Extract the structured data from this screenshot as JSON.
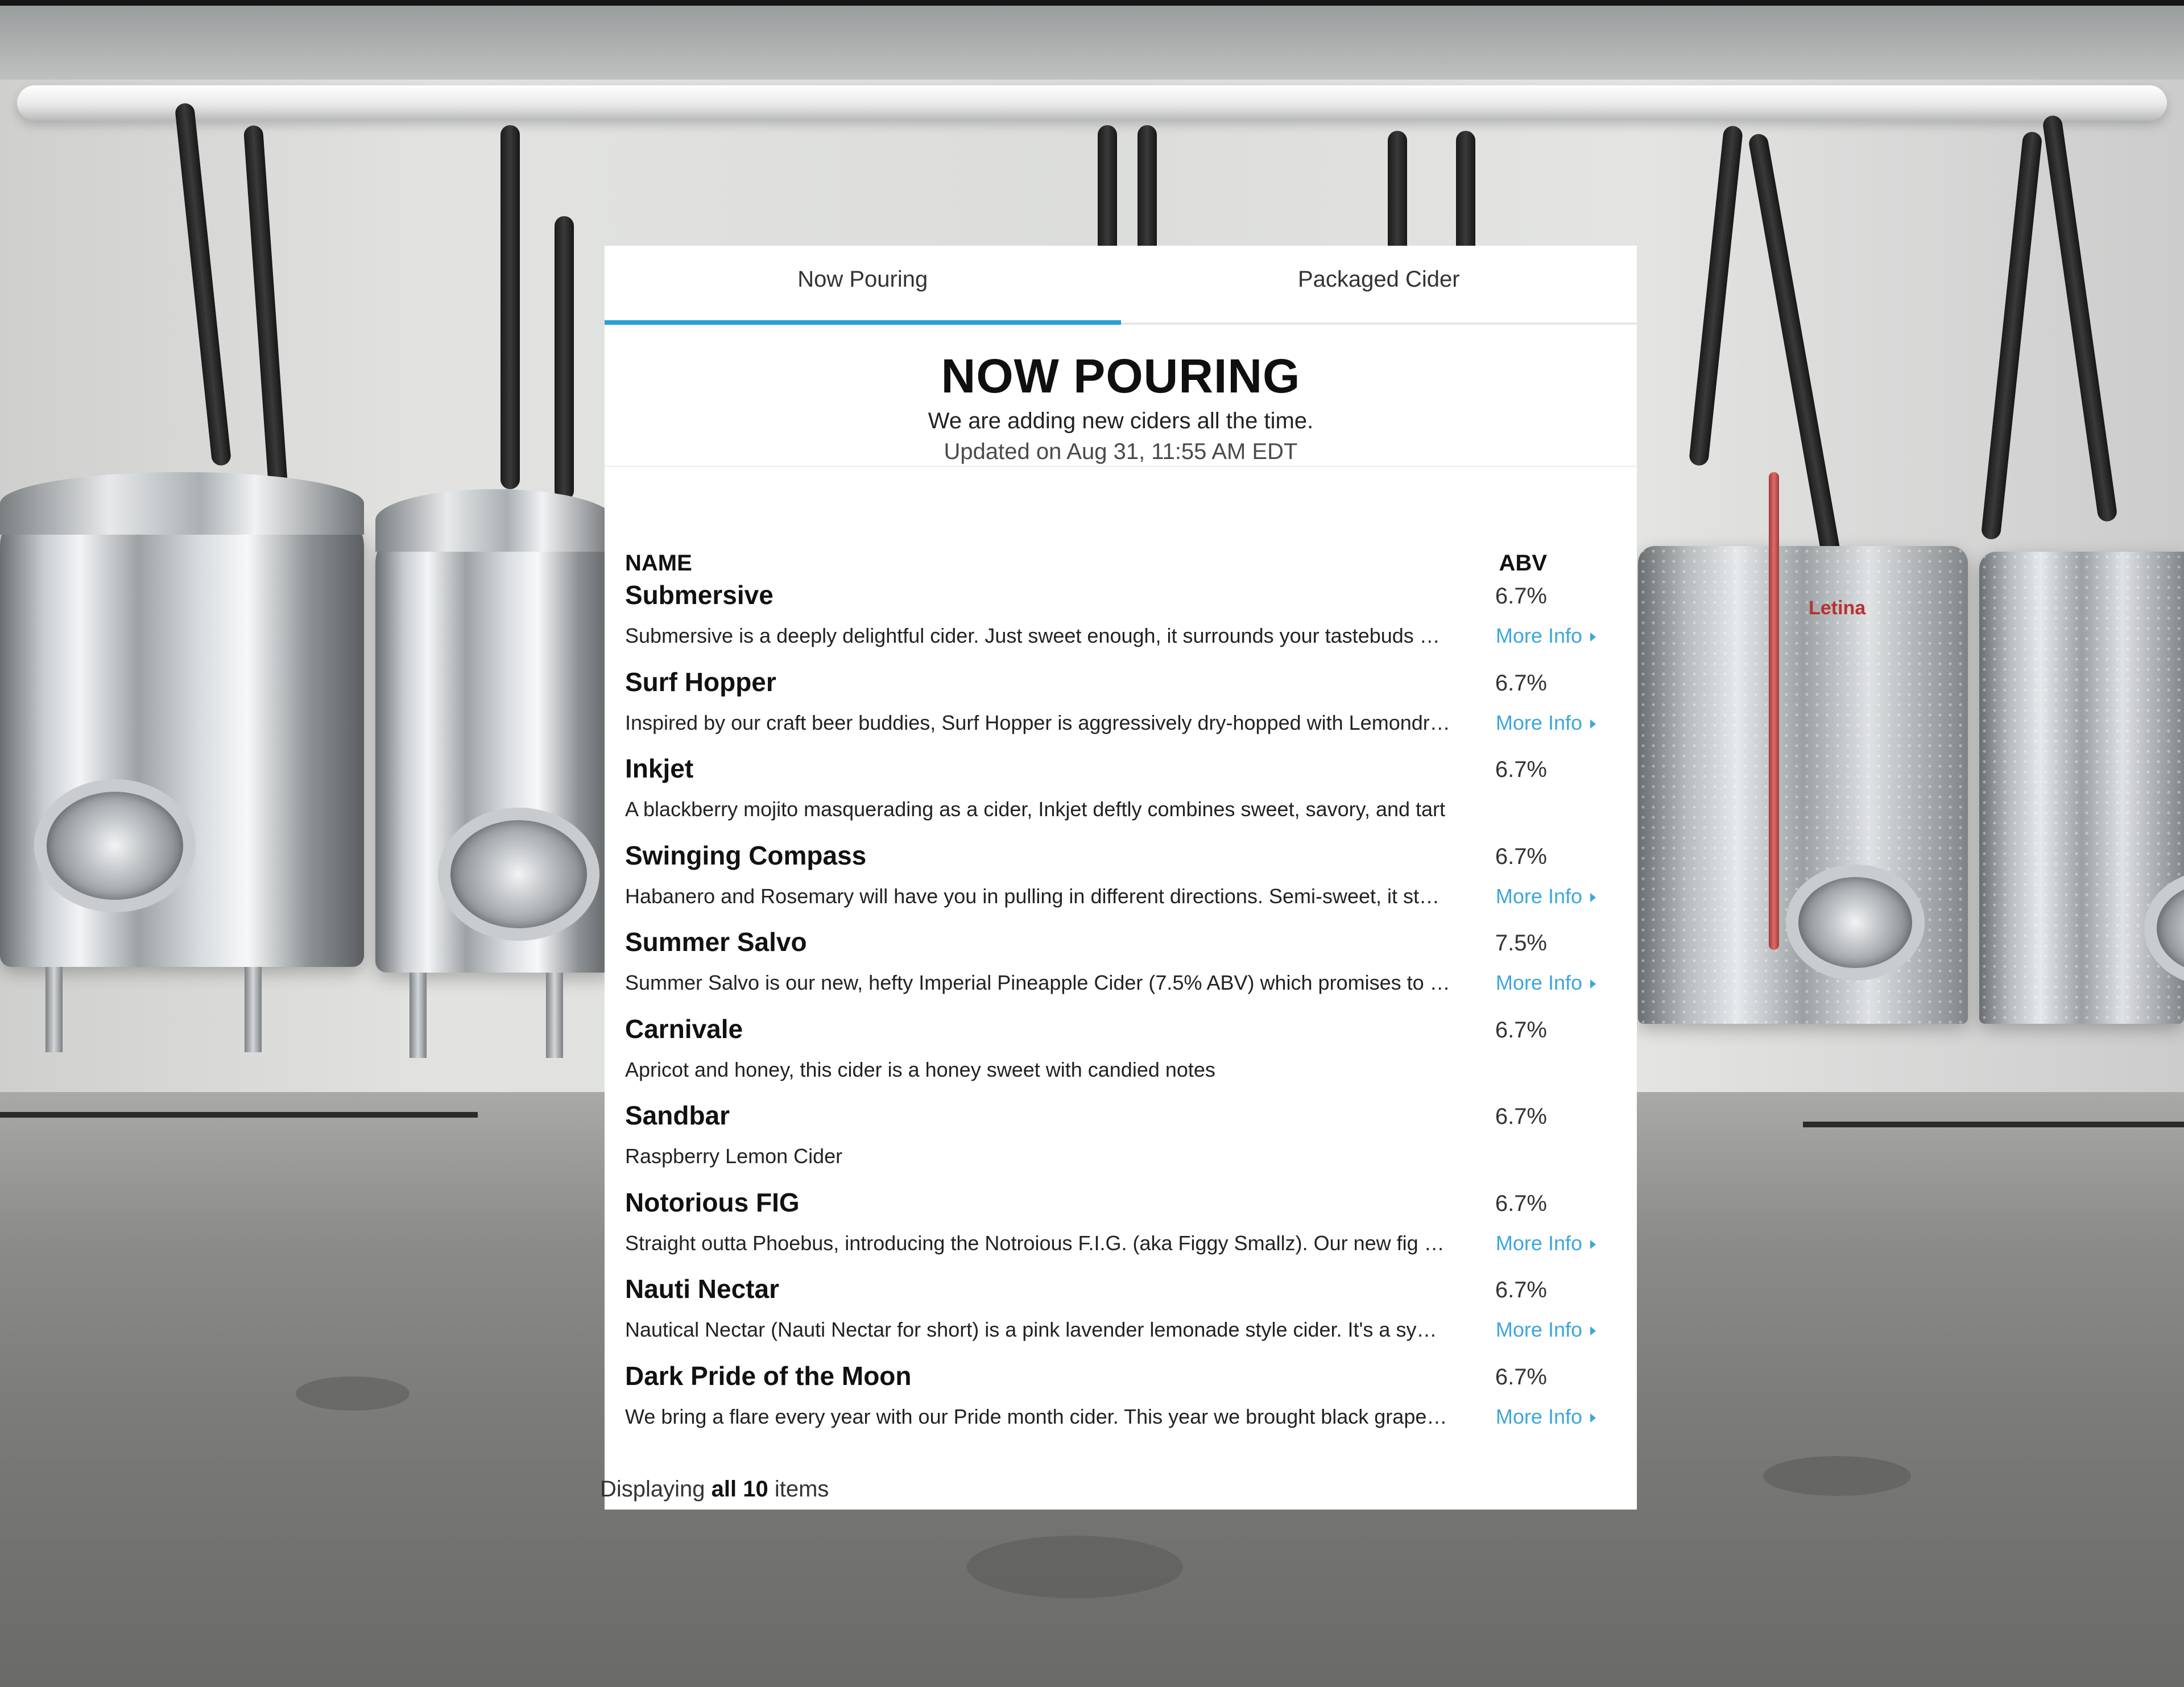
{
  "tabs": [
    {
      "label": "Now Pouring",
      "active": true
    },
    {
      "label": "Packaged Cider",
      "active": false
    }
  ],
  "header": {
    "title": "NOW POURING",
    "subtitle": "We are adding new ciders all the time.",
    "updated": "Updated on Aug 31, 11:55 AM EDT"
  },
  "columns": {
    "name": "NAME",
    "abv": "ABV"
  },
  "more_info_label": "More Info",
  "items": [
    {
      "name": "Submersive",
      "abv": "6.7%",
      "description": "Submersive is a deeply delightful cider. Just sweet enough, it surrounds your tastebuds …",
      "more_info": true
    },
    {
      "name": "Surf Hopper",
      "abv": "6.7%",
      "description": "Inspired by our craft beer buddies, Surf Hopper is aggressively dry-hopped with Lemondr…",
      "more_info": true
    },
    {
      "name": "Inkjet",
      "abv": "6.7%",
      "description": "A blackberry mojito masquerading as a cider, Inkjet deftly combines sweet, savory, and tart",
      "more_info": false
    },
    {
      "name": "Swinging Compass",
      "abv": "6.7%",
      "description": "Habanero and Rosemary will have you in pulling in different directions. Semi-sweet, it st…",
      "more_info": true
    },
    {
      "name": "Summer Salvo",
      "abv": "7.5%",
      "description": "Summer Salvo is our new, hefty Imperial Pineapple Cider (7.5% ABV) which promises to …",
      "more_info": true
    },
    {
      "name": "Carnivale",
      "abv": "6.7%",
      "description": "Apricot and honey, this cider is a honey sweet with candied notes",
      "more_info": false
    },
    {
      "name": "Sandbar",
      "abv": "6.7%",
      "description": "Raspberry Lemon Cider",
      "more_info": false
    },
    {
      "name": "Notorious FIG",
      "abv": "6.7%",
      "description": "Straight outta Phoebus, introducing the Notroious F.I.G. (aka Figgy Smallz). Our new fig …",
      "more_info": true
    },
    {
      "name": "Nauti Nectar",
      "abv": "6.7%",
      "description": "Nautical Nectar (Nauti Nectar for short) is a pink lavender lemonade style cider. It's a sy…",
      "more_info": true
    },
    {
      "name": "Dark Pride of the Moon",
      "abv": "6.7%",
      "description": "We bring a flare every year with our Pride month cider. This year we brought black grape…",
      "more_info": true
    }
  ],
  "footer": {
    "prefix": "Displaying ",
    "count": "all 10",
    "suffix": " items"
  },
  "background": {
    "tank_brand": "Letina"
  },
  "colors": {
    "accent": "#2b9fd8",
    "link": "#3ea6dc"
  }
}
